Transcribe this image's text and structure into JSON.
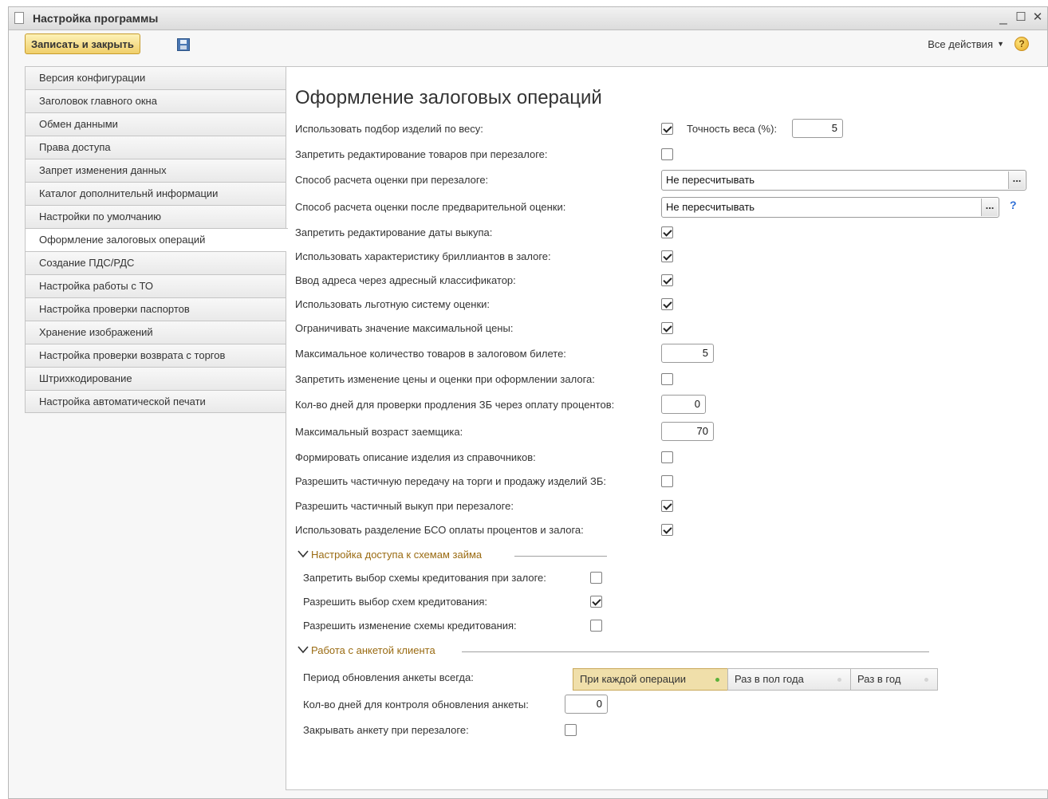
{
  "window": {
    "title": "Настройка программы",
    "minimize": "_",
    "maximize": "☐",
    "close": "✕"
  },
  "toolbar": {
    "save_close": "Записать и закрыть",
    "all_actions": "Все действия",
    "help": "?"
  },
  "sidebar": {
    "items": [
      {
        "label": "Версия конфигурации"
      },
      {
        "label": "Заголовок главного окна"
      },
      {
        "label": "Обмен данными"
      },
      {
        "label": "Права доступа"
      },
      {
        "label": "Запрет изменения данных"
      },
      {
        "label": "Каталог дополнительнй информации"
      },
      {
        "label": "Настройки по умолчанию"
      },
      {
        "label": "Оформление залоговых операций",
        "active": true
      },
      {
        "label": "Создание ПДС/РДС"
      },
      {
        "label": "Настройка работы с ТО"
      },
      {
        "label": "Настройка проверки паспортов"
      },
      {
        "label": "Хранение изображений"
      },
      {
        "label": "Настройка проверки возврата с торгов"
      },
      {
        "label": "Штрихкодирование"
      },
      {
        "label": "Настройка автоматической печати"
      }
    ]
  },
  "panel": {
    "title": "Оформление залоговых операций",
    "weight_precision_label": "Точность веса (%):",
    "weight_precision_value": "5",
    "rows": [
      {
        "label": "Использовать подбор изделий по весу:",
        "checked": true
      },
      {
        "label": "Запретить редактирование товаров при перезалоге:",
        "checked": false
      },
      {
        "label": "Способ расчета оценки при перезалоге:",
        "value": "Не пересчитывать"
      },
      {
        "label": "Способ расчета оценки после предварительной оценки:",
        "value": "Не пересчитывать"
      },
      {
        "label": "Запретить редактирование даты выкупа:",
        "checked": true
      },
      {
        "label": "Использовать характеристику бриллиантов в залоге:",
        "checked": true
      },
      {
        "label": "Ввод адреса через адресный классификатор:",
        "checked": true
      },
      {
        "label": "Использовать льготную систему оценки:",
        "checked": true
      },
      {
        "label": "Ограничивать значение максимальной цены:",
        "checked": true
      },
      {
        "label": "Максимальное количество товаров в залоговом билете:",
        "value": "5"
      },
      {
        "label": "Запретить изменение цены и оценки при оформлении залога:",
        "checked": false
      },
      {
        "label": "Кол-во дней для проверки продления ЗБ через оплату процентов:",
        "value": "0"
      },
      {
        "label": "Максимальный возраст заемщика:",
        "value": "70"
      },
      {
        "label": "Формировать описание изделия из справочников:",
        "checked": false
      },
      {
        "label": "Разрешить частичную передачу на торги и продажу изделий ЗБ:",
        "checked": false
      },
      {
        "label": "Разрешить частичный выкуп при перезалоге:",
        "checked": true
      },
      {
        "label": "Использовать разделение БСО оплаты процентов и залога:",
        "checked": true
      }
    ],
    "group_schemes": {
      "title": "Настройка доступа к схемам займа",
      "rows": [
        {
          "label": "Запретить выбор схемы кредитования при залоге:",
          "checked": false
        },
        {
          "label": "Разрешить выбор схем кредитования:",
          "checked": true
        },
        {
          "label": "Разрешить изменение схемы кредитования:",
          "checked": false
        }
      ]
    },
    "group_survey": {
      "title": "Работа с анкетой клиента",
      "period_label": "Период обновления анкеты всегда:",
      "period_options": [
        {
          "label": "При каждой операции",
          "selected": true
        },
        {
          "label": "Раз в пол года",
          "selected": false
        },
        {
          "label": "Раз в год",
          "selected": false
        }
      ],
      "days_label": "Кол-во дней для контроля обновления анкеты:",
      "days_value": "0",
      "close_label": "Закрывать анкету при перезалоге:",
      "close_checked": false
    }
  }
}
